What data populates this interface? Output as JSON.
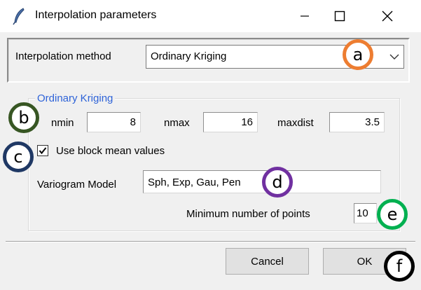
{
  "window": {
    "title": "Interpolation parameters"
  },
  "method": {
    "label": "Interpolation method",
    "selected": "Ordinary Kriging"
  },
  "group": {
    "title": "Ordinary Kriging",
    "nmin_label": "nmin",
    "nmin_value": "8",
    "nmax_label": "nmax",
    "nmax_value": "16",
    "maxdist_label": "maxdist",
    "maxdist_value": "3.5",
    "block_mean_label": "Use block mean values",
    "block_mean_checked": true,
    "variogram_label": "Variogram Model",
    "variogram_value": "Sph, Exp, Gau, Pen",
    "min_points_label": "Minimum number of points",
    "min_points_value": "10"
  },
  "buttons": {
    "cancel": "Cancel",
    "ok": "OK"
  },
  "annotations": {
    "a": {
      "letter": "a",
      "color": "#ed7d31"
    },
    "b": {
      "letter": "b",
      "color": "#375623"
    },
    "c": {
      "letter": "c",
      "color": "#1f3864"
    },
    "d": {
      "letter": "d",
      "color": "#7030a0"
    },
    "e": {
      "letter": "e",
      "color": "#00b050"
    },
    "f": {
      "letter": "f",
      "color": "#000000"
    }
  },
  "icons": {
    "app": "feather-icon",
    "minimize": "minimize-icon",
    "maximize": "maximize-icon",
    "close": "close-icon",
    "dropdown": "chevron-down-icon",
    "check": "checkmark-icon"
  }
}
